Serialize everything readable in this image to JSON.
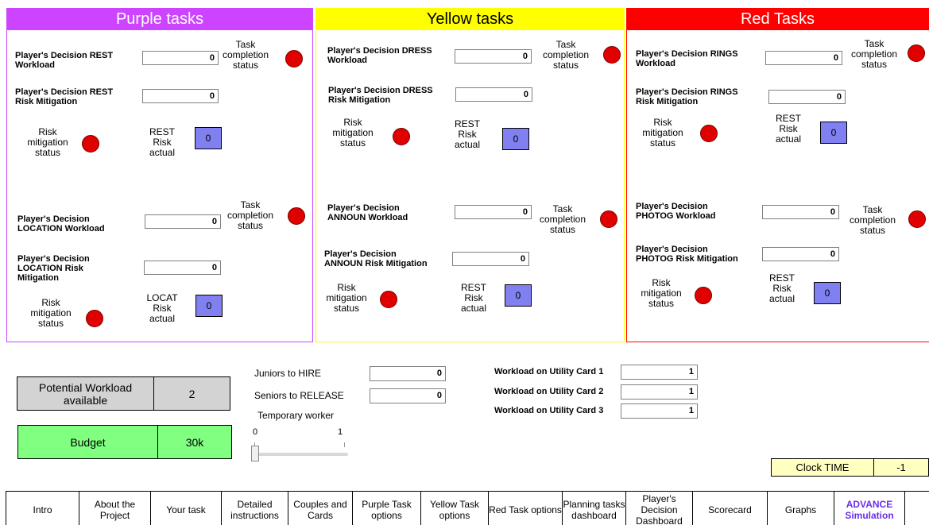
{
  "colors": {
    "purple": "#cc44ff",
    "yellow": "#ffff00",
    "red": "#ff0000",
    "status_dot": "#e00000",
    "risk_box": "#8080f0",
    "workload_box": "#d3d3d3",
    "budget_box": "#80ff80",
    "clock_box": "#ffffc0",
    "active_tab_text": "#6a2ee8"
  },
  "purple": {
    "title": "Purple tasks",
    "t1_workload_label": [
      "Player's Decision REST",
      "Workload"
    ],
    "t1_workload_value": "0",
    "t1_risk_label": [
      "Player's Decision REST",
      "Risk Mitigation"
    ],
    "t1_risk_value": "0",
    "t1_completion": [
      "Task",
      "completion",
      "status"
    ],
    "t1_mitigation": [
      "Risk",
      "mitigation",
      "status"
    ],
    "t1_actual": [
      "REST",
      "Risk",
      "actual"
    ],
    "t1_actual_value": "0",
    "t2_workload_label": [
      "Player's Decision",
      "LOCATION Workload"
    ],
    "t2_workload_value": "0",
    "t2_risk_label": [
      "Player's Decision",
      "LOCATION Risk",
      "Mitigation"
    ],
    "t2_risk_value": "0",
    "t2_completion": [
      "Task",
      "completion",
      "status"
    ],
    "t2_mitigation": [
      "Risk",
      "mitigation",
      "status"
    ],
    "t2_actual": [
      "LOCAT",
      "Risk",
      "actual"
    ],
    "t2_actual_value": "0"
  },
  "yellow": {
    "title": "Yellow tasks",
    "t1_workload_label": [
      "Player's Decision DRESS",
      "Workload"
    ],
    "t1_workload_value": "0",
    "t1_risk_label": [
      "Player's Decision DRESS",
      "Risk Mitigation"
    ],
    "t1_risk_value": "0",
    "t1_completion": [
      "Task",
      "completion",
      "status"
    ],
    "t1_mitigation": [
      "Risk",
      "mitigation",
      "status"
    ],
    "t1_actual": [
      "REST",
      "Risk",
      "actual"
    ],
    "t1_actual_value": "0",
    "t2_workload_label": [
      "Player's Decision",
      "ANNOUN Workload"
    ],
    "t2_workload_value": "0",
    "t2_risk_label": [
      "Player's Decision",
      "ANNOUN Risk Mitigation"
    ],
    "t2_risk_value": "0",
    "t2_completion": [
      "Task",
      "completion",
      "status"
    ],
    "t2_mitigation": [
      "Risk",
      "mitigation",
      "status"
    ],
    "t2_actual": [
      "REST",
      "Risk",
      "actual"
    ],
    "t2_actual_value": "0"
  },
  "red": {
    "title": "Red Tasks",
    "t1_workload_label": [
      "Player's Decision RINGS",
      "Workload"
    ],
    "t1_workload_value": "0",
    "t1_risk_label": [
      "Player's Decision RINGS",
      "Risk Mitigation"
    ],
    "t1_risk_value": "0",
    "t1_completion": [
      "Task",
      "completion",
      "status"
    ],
    "t1_mitigation": [
      "Risk",
      "mitigation",
      "status"
    ],
    "t1_actual": [
      "REST",
      "Risk",
      "actual"
    ],
    "t1_actual_value": "0",
    "t2_workload_label": [
      "Player's Decision",
      "PHOTOG Workload"
    ],
    "t2_workload_value": "0",
    "t2_risk_label": [
      "Player's Decision",
      "PHOTOG Risk Mitigation"
    ],
    "t2_risk_value": "0",
    "t2_completion": [
      "Task",
      "completion",
      "status"
    ],
    "t2_mitigation": [
      "Risk",
      "mitigation",
      "status"
    ],
    "t2_actual": [
      "REST",
      "Risk",
      "actual"
    ],
    "t2_actual_value": "0"
  },
  "resources": {
    "workload_label": [
      "Potential Workload",
      "available"
    ],
    "workload_value": "2",
    "budget_label": "Budget",
    "budget_value": "30k",
    "juniors_label": "Juniors to HIRE",
    "juniors_value": "0",
    "seniors_label": "Seniors to RELEASE",
    "seniors_value": "0",
    "temp_label": "Temporary worker",
    "slider_min": "0",
    "slider_max": "1",
    "slider_value": 0,
    "util1_label": "Workload on Utility Card 1",
    "util1_value": "1",
    "util2_label": "Workload on Utility Card 2",
    "util2_value": "1",
    "util3_label": "Workload on Utility Card 3",
    "util3_value": "1",
    "clock_label": "Clock TIME",
    "clock_value": "-1"
  },
  "nav": [
    {
      "label": "Intro"
    },
    {
      "label": "About the Project"
    },
    {
      "label": "Your task"
    },
    {
      "label": "Detailed instructions"
    },
    {
      "label": "Couples and Cards"
    },
    {
      "label": "Purple Task options"
    },
    {
      "label": "Yellow Task options"
    },
    {
      "label": "Red Task options"
    },
    {
      "label": "Planning tasks dashboard"
    },
    {
      "label": "Player's Decision Dashboard"
    },
    {
      "label": "Scorecard"
    },
    {
      "label": "Graphs"
    },
    {
      "label": "ADVANCE Simulation"
    }
  ]
}
